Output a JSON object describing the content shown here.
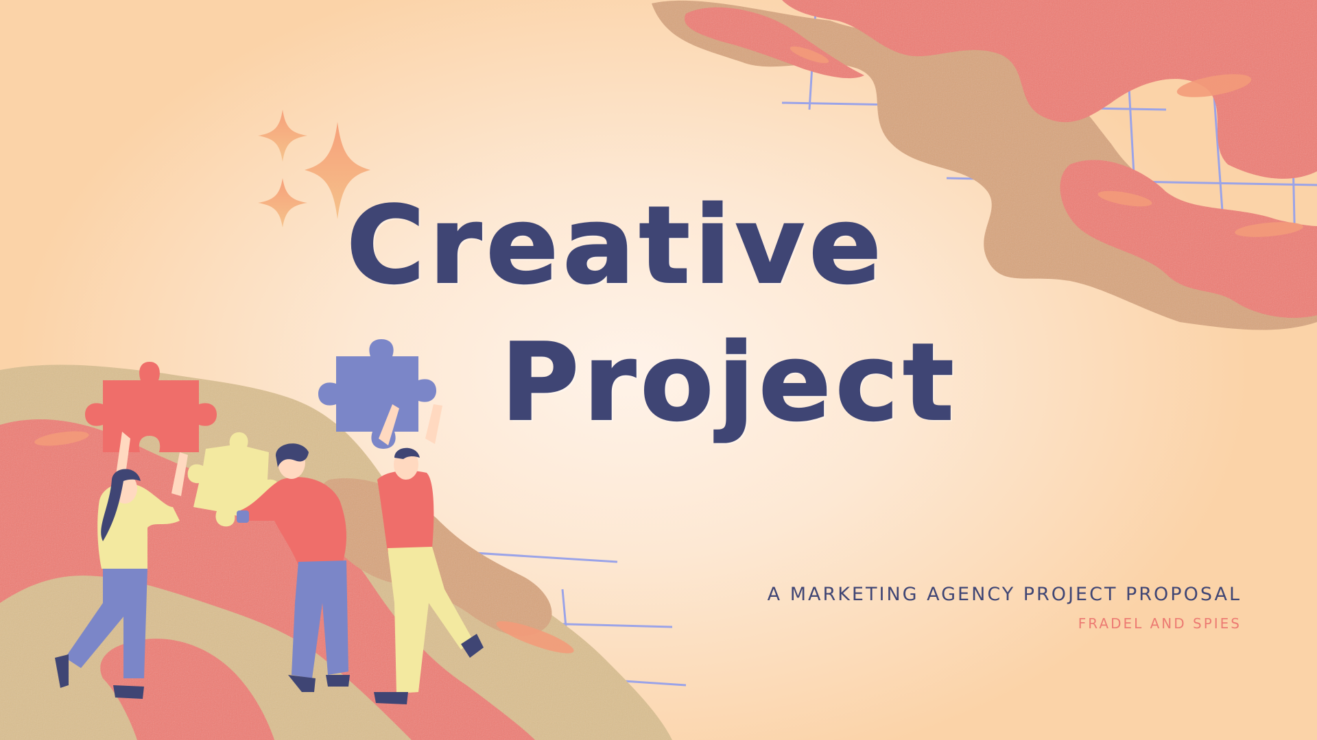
{
  "slide": {
    "title_line_1": "Creative",
    "title_line_2": "Project",
    "subtitle": "A MARKETING AGENCY PROJECT PROPOSAL",
    "author": "FRADEL AND SPIES"
  },
  "colors": {
    "background": "#fde8d3",
    "title": "#3f4574",
    "accent_coral": "#ec7a72",
    "accent_sand": "#dcc08f",
    "accent_blue": "#7b86c8",
    "accent_yellow": "#f3e9a0",
    "grid_line": "#9aa3e8"
  },
  "icons": [
    "sparkle-icon",
    "puzzle-piece-icon",
    "person-illustration"
  ]
}
